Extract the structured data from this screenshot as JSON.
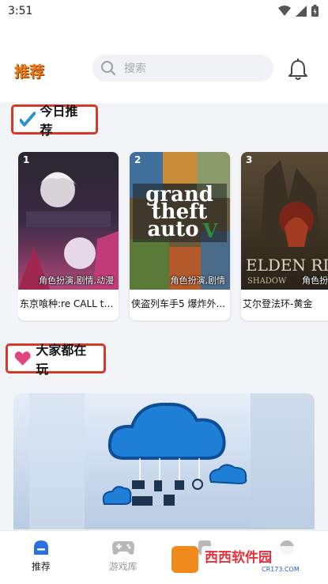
{
  "status_bar": {
    "time": "3:51"
  },
  "header": {
    "title": "推荐",
    "search_placeholder": "搜索"
  },
  "today": {
    "title": "今日推荐",
    "cards": [
      {
        "rank": "1",
        "tags": "角色扮演,剧情,动漫",
        "title": "东京喰种:re CALL to ..."
      },
      {
        "rank": "2",
        "tags": "角色扮演,剧情",
        "title": "侠盗列车手5 爆炸外..."
      },
      {
        "rank": "3",
        "tags": "角色扮演",
        "title": "艾尔登法环-黄金"
      }
    ]
  },
  "popular": {
    "title": "大家都在玩"
  },
  "tabbar": {
    "tabs": [
      {
        "label": "推荐"
      },
      {
        "label": "游戏库"
      },
      {
        "label": ""
      },
      {
        "label": ""
      }
    ]
  },
  "watermark": {
    "text": "西西软件园",
    "sub": "CR173.COM"
  },
  "colors": {
    "accent": "#d33a2a",
    "brand_orange": "#f07a1a",
    "active_tab": "#2a6fe6"
  }
}
